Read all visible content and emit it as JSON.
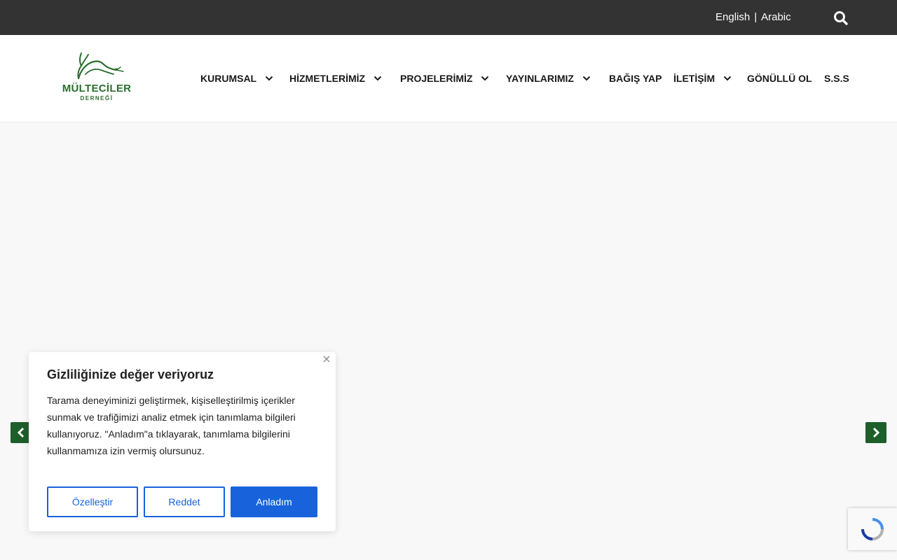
{
  "topbar": {
    "lang_english": "English",
    "lang_separator": "|",
    "lang_arabic": "Arabic",
    "search_icon": "search-icon"
  },
  "logo": {
    "line1": "MÜLTECİLER",
    "line2": "DERNEĞİ",
    "brand_color": "#2b6e2f"
  },
  "nav": {
    "items": [
      {
        "label": "KURUMSAL",
        "dropdown": true
      },
      {
        "label": "HİZMETLERİMİZ",
        "dropdown": true
      },
      {
        "label": "PROJELERİMİZ",
        "dropdown": true
      },
      {
        "label": "YAYINLARIMIZ",
        "dropdown": true
      },
      {
        "label": "BAĞIŞ YAP",
        "dropdown": false
      },
      {
        "label": "İLETİŞİM",
        "dropdown": true
      },
      {
        "label": "GÖNÜLLÜ OL",
        "dropdown": false
      },
      {
        "label": "S.S.S",
        "dropdown": false
      }
    ]
  },
  "slider": {
    "prev_icon": "chevron-left-icon",
    "next_icon": "chevron-right-icon",
    "arrow_color": "#1e5e2a"
  },
  "cookie": {
    "title": "Gizliliğinize değer veriyoruz",
    "body": "Tarama deneyiminizi geliştirmek, kişiselleştirilmiş içerikler sunmak ve trafiğimizi analiz etmek için tanımlama bilgileri kullanıyoruz. \"Anladım\"a tıklayarak, tanımlama bilgilerini kullanmamıza izin vermiş olursunuz.",
    "customize_label": "Özelleştir",
    "reject_label": "Reddet",
    "accept_label": "Anladım",
    "accent_color": "#1863dc"
  }
}
